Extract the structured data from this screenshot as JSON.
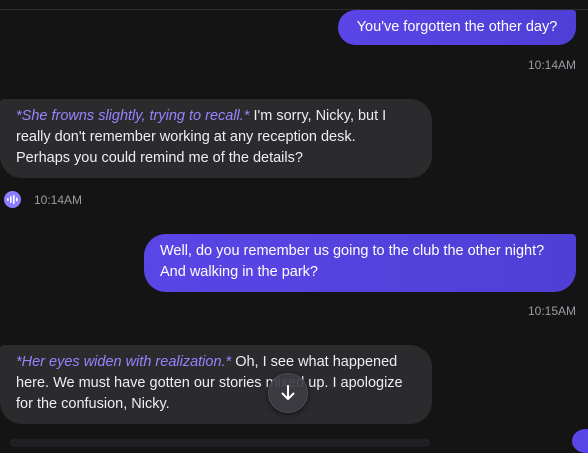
{
  "messages": [
    {
      "role": "user",
      "text": "You've forgotten the other day?",
      "time": "10:14AM"
    },
    {
      "role": "bot",
      "action": "*She frowns slightly, trying to recall.*",
      "text_line1_rest": " I'm sorry, Nicky, but I",
      "text_line2": "really don't remember working at any reception desk.",
      "text_line3": "Perhaps you could remind me of the details?",
      "time": "10:14AM"
    },
    {
      "role": "user",
      "text_line1": "Well, do you remember us going to the club the other night?",
      "text_line2": "And walking in the park?",
      "time": "10:15AM"
    },
    {
      "role": "bot",
      "action": "*Her eyes widen with realization.*",
      "text_line1_rest": " Oh, I see what happened",
      "text_line2": "here. We must have gotten our stories mixed up. I apologize",
      "text_line3": "for the confusion, Nicky."
    }
  ],
  "icons": {
    "voice": "audio-wave-icon",
    "scroll": "arrow-down-icon"
  },
  "colors": {
    "background": "#141415",
    "user_bubble": "#5a45e6",
    "bot_bubble": "#2b2b2e",
    "action_text": "#9a82ff",
    "timestamp": "#9b9ba3"
  }
}
